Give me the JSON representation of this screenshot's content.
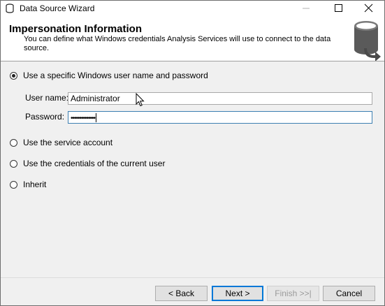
{
  "window": {
    "title": "Data Source Wizard"
  },
  "header": {
    "title": "Impersonation Information",
    "description": "You can define what Windows credentials Analysis Services will use to connect to the data source.",
    "graphic_icon": "database-icon"
  },
  "options": [
    {
      "label": "Use a specific Windows user name and password",
      "checked": true
    },
    {
      "label": "Use the service account",
      "checked": false
    },
    {
      "label": "Use the credentials of the current user",
      "checked": false
    },
    {
      "label": "Inherit",
      "checked": false
    }
  ],
  "credentials": {
    "username_label": "User name:",
    "username_value": "Administrator",
    "password_label": "Password:",
    "password_masked": "••••••••••••••"
  },
  "buttons": {
    "back": "< Back",
    "next": "Next >",
    "finish": "Finish >>|",
    "cancel": "Cancel"
  },
  "colors": {
    "focus_border": "#3c7fb1",
    "default_button_border": "#0078d7"
  }
}
